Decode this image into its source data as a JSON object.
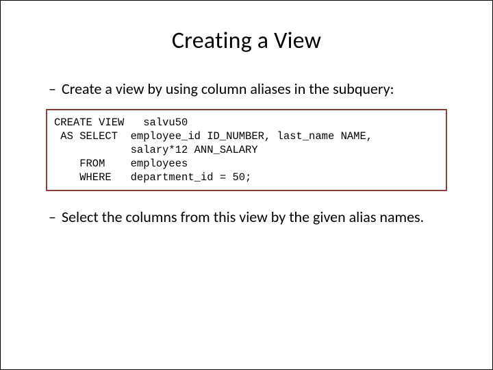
{
  "title": "Creating a View",
  "bullet1": "Create a view by using column aliases in the subquery:",
  "code": "CREATE VIEW   salvu50\n AS SELECT  employee_id ID_NUMBER, last_name NAME,\n            salary*12 ANN_SALARY\n    FROM    employees\n    WHERE   department_id = 50;",
  "bullet2": "Select the columns from this view by the given alias names."
}
